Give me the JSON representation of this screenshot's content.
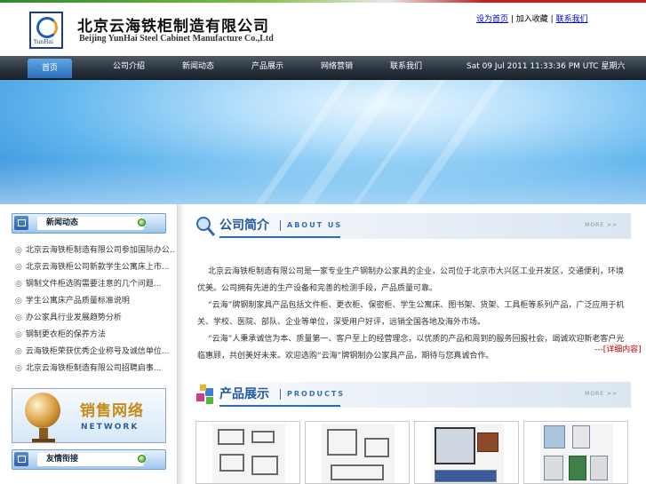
{
  "header": {
    "logo_caption": "YunHai",
    "company_cn": "北京云海铁柜制造有限公司",
    "company_en": "Beijing YunHai Steel Cabinet Manufacture Co.,Ltd",
    "toplinks": [
      "设为首页",
      "加入收藏",
      "联系我们"
    ],
    "toplinks_sep": " | "
  },
  "nav": {
    "items": [
      "首页",
      "公司介绍",
      "新闻动态",
      "产品展示",
      "网络营销",
      "联系我们"
    ],
    "active_index": 0,
    "date": "Sat 09 Jul 2011 11:33:36 PM UTC 星期六"
  },
  "sidebar": {
    "news_title": "新闻动态",
    "news_items": [
      "北京云海铁柜制造有限公司参加国际办公...",
      "北京云海铁柜公司新款学生公寓床上市...",
      "钢制文件柜选购需要注意的几个问题...",
      "学生公寓床产品质量标准说明",
      "办公家具行业发展趋势分析",
      "钢制更衣柜的保养方法",
      "云海铁柜荣获优秀企业称号及诚信单位...",
      "北京云海铁柜制造有限公司招聘启事..."
    ],
    "bullet": "◎",
    "sales_cn": "销售网络",
    "sales_en": "NETWORK",
    "links_title": "友情衔接"
  },
  "about": {
    "title_cn": "公司简介",
    "title_en": "ABOUT US",
    "more": "MORE >>",
    "paragraphs": [
      "北京云海铁柜制造有限公司是一家专业生产钢制办公家具的企业，公司位于北京市大兴区工业开发区，交通便利，环境优美。公司拥有先进的生产设备和完善的检测手段，产品质量可靠。",
      "“云海”牌钢制家具产品包括文件柜、更衣柜、保密柜、学生公寓床、图书架、货架、工具柜等系列产品，广泛应用于机关、学校、医院、部队、企业等单位，深受用户好评，远销全国各地及海外市场。",
      "“云海”人秉承诚信为本、质量第一、客户至上的经营理念，以优质的产品和周到的服务回报社会，竭诚欢迎新老客户光临惠顾，共创美好未来。欢迎选购“云海”牌钢制办公家具产品，期待与您真诚合作。"
    ],
    "detail_link": "---[详细内容]"
  },
  "products": {
    "title_cn": "产品展示",
    "title_en": "PRODUCTS",
    "more": "MORE >>",
    "items": [
      "bunk-bed-set",
      "metal-bed-frame",
      "office-partition",
      "steel-lockers"
    ]
  },
  "colors": {
    "nav_bg": "#2b3540",
    "accent_blue": "#23599e",
    "link_red": "#cc0000",
    "link_blue": "#0000cc"
  }
}
